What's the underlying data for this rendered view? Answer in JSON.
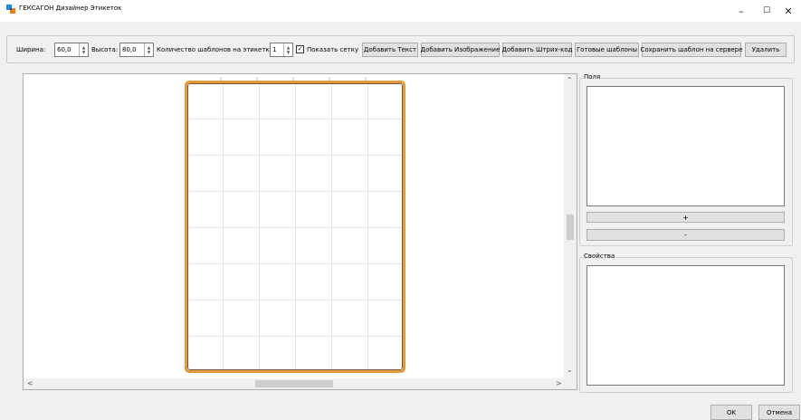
{
  "window": {
    "title": "ГЕКСАГОН Дизайнер Этикеток",
    "minimize_glyph": "–",
    "maximize_glyph": "☐",
    "close_glyph": "✕"
  },
  "toolbar": {
    "width_label": "Ширина:",
    "width_value": "60,0",
    "height_label": "Высота:",
    "height_value": "80,0",
    "templates_count_label": "Количество шаблонов на этикетке:",
    "templates_count_value": "1",
    "show_grid_label": "Показать сетку",
    "show_grid_checked": true,
    "check_glyph": "✓",
    "spin_up_glyph": "▲",
    "spin_down_glyph": "▼",
    "buttons": {
      "add_text": "Добавить Текст",
      "add_image": "Добавить Изображение",
      "add_barcode": "Добавить Штрих-код",
      "ready_templates": "Готовые шаблоны",
      "save_template": "Сохранить шаблон на сервере",
      "delete": "Удалить"
    }
  },
  "scrollbars": {
    "up_glyph": "⌃",
    "down_glyph": "⌄",
    "left_glyph": "<",
    "right_glyph": ">"
  },
  "fields_panel": {
    "title": "Поля",
    "add_button": "+",
    "remove_button": "-"
  },
  "properties_panel": {
    "title": "Свойства"
  },
  "dialog": {
    "ok": "OK",
    "cancel": "Отмена"
  },
  "colors": {
    "label_border": "#e39a37",
    "grid_line": "#e3e3e3"
  }
}
